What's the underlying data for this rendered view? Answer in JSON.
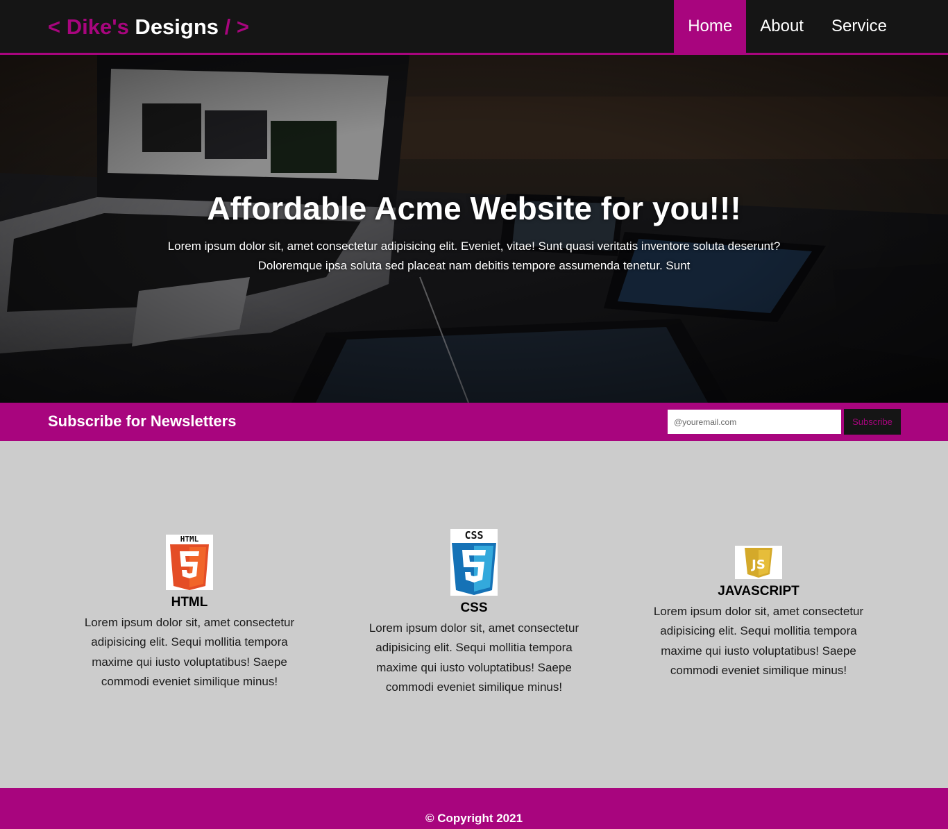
{
  "header": {
    "logo_open": "< ",
    "logo_name": "Dike's",
    "logo_designs": " Designs ",
    "logo_close": "/ >",
    "nav": [
      {
        "label": "Home",
        "active": true
      },
      {
        "label": "About",
        "active": false
      },
      {
        "label": "Service",
        "active": false
      }
    ]
  },
  "hero": {
    "title": "Affordable Acme Website for you!!!",
    "text": "Lorem ipsum dolor sit, amet consectetur adipisicing elit. Eveniet, vitae! Sunt quasi veritatis inventore soluta deserunt? Doloremque ipsa soluta sed placeat nam debitis tempore assumenda tenetur. Sunt"
  },
  "newsletter": {
    "title": "Subscribe for Newsletters",
    "email_placeholder": "@youremail.com",
    "button_label": "Subscribe"
  },
  "boxes": [
    {
      "icon": "html5-logo-icon",
      "logo_text": "HTML",
      "title": "HTML",
      "text": "Lorem ipsum dolor sit, amet consectetur adipisicing elit. Sequi mollitia tempora maxime qui iusto voluptatibus! Saepe commodi eveniet similique minus!"
    },
    {
      "icon": "css3-logo-icon",
      "logo_text": "CSS",
      "title": "CSS",
      "text": "Lorem ipsum dolor sit, amet consectetur adipisicing elit. Sequi mollitia tempora maxime qui iusto voluptatibus! Saepe commodi eveniet similique minus!"
    },
    {
      "icon": "javascript-logo-icon",
      "logo_text": "JS",
      "title": "JAVASCRIPT",
      "text": "Lorem ipsum dolor sit, amet consectetur adipisicing elit. Sequi mollitia tempora maxime qui iusto voluptatibus! Saepe commodi eveniet similique minus!"
    }
  ],
  "footer": {
    "copyright": "© Copyright 2021"
  },
  "colors": {
    "accent": "#a8057e",
    "dark": "#151515",
    "content_bg": "#cccccc"
  }
}
